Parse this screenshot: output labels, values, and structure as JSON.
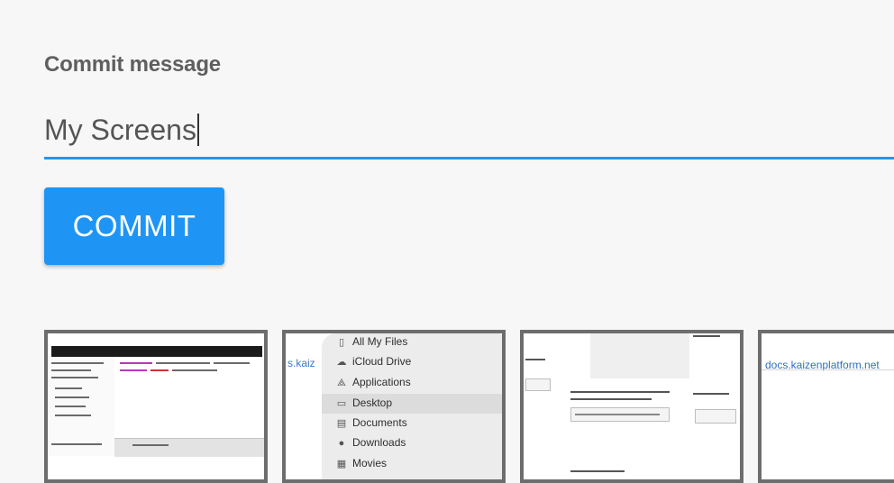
{
  "form": {
    "label": "Commit message",
    "input_value": "My Screens",
    "input_placeholder": "",
    "commit_label": "COMMIT"
  },
  "colors": {
    "background": "#f7f7f7",
    "accent": "#2196f3",
    "button": "#1e95f5",
    "label": "#5f5f5f"
  },
  "thumbnails": [
    {
      "name": "screenshot-thumbnail-code-editor"
    },
    {
      "name": "screenshot-thumbnail-finder",
      "link_fragment": "s.kaiz",
      "menu_items": [
        {
          "label": "All My Files",
          "icon": "files-icon"
        },
        {
          "label": "iCloud Drive",
          "icon": "cloud-icon"
        },
        {
          "label": "Applications",
          "icon": "applications-icon"
        },
        {
          "label": "Desktop",
          "icon": "desktop-icon"
        },
        {
          "label": "Documents",
          "icon": "document-icon"
        },
        {
          "label": "Downloads",
          "icon": "download-icon"
        },
        {
          "label": "Movies",
          "icon": "movies-icon"
        }
      ]
    },
    {
      "name": "screenshot-thumbnail-dialog"
    },
    {
      "name": "screenshot-thumbnail-web",
      "link": "docs.kaizenplatform.net"
    }
  ]
}
